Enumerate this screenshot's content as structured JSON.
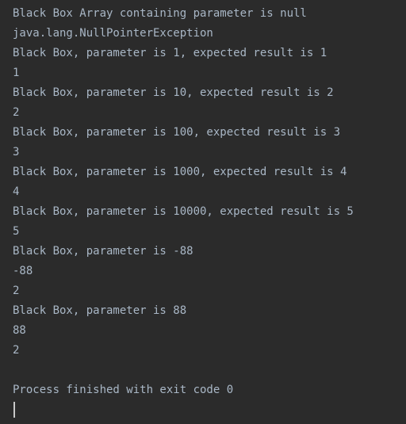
{
  "console": {
    "lines": [
      "Black Box Array containing parameter is null",
      "java.lang.NullPointerException",
      "Black Box, parameter is 1, expected result is 1",
      "1",
      "Black Box, parameter is 10, expected result is 2",
      "2",
      "Black Box, parameter is 100, expected result is 3",
      "3",
      "Black Box, parameter is 1000, expected result is 4",
      "4",
      "Black Box, parameter is 10000, expected result is 5",
      "5",
      "Black Box, parameter is -88",
      "-88",
      "2",
      "Black Box, parameter is 88",
      "88",
      "2",
      "",
      "Process finished with exit code 0"
    ]
  },
  "colors": {
    "background": "#2b2b2b",
    "text": "#a9b7c6",
    "caret": "#c8c8c8"
  }
}
